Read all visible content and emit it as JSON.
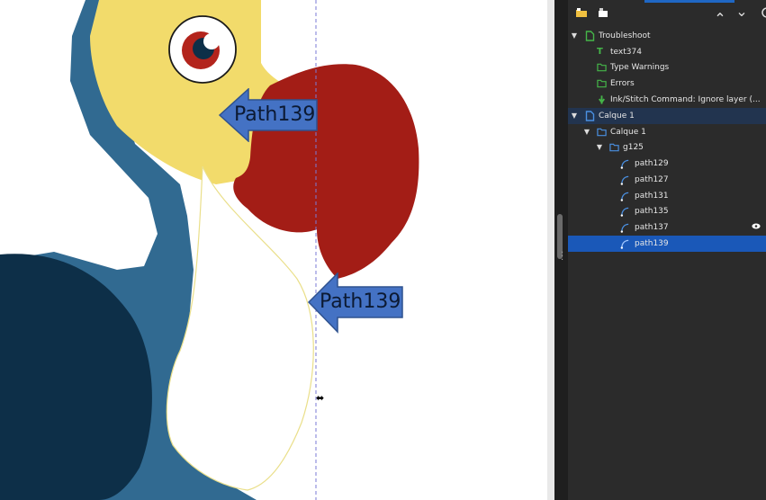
{
  "canvas": {
    "callouts": [
      {
        "id": "upper",
        "label": "Path139"
      },
      {
        "id": "lower",
        "label": "Path139"
      }
    ],
    "cursor_glyph": "⬌"
  },
  "colors": {
    "beak_red": "#a31d16",
    "head_yellow": "#f2db6b",
    "body_blue": "#316a91",
    "wing_dark": "#0d2f48",
    "callout_blue": "#4472c4",
    "selection": "#1a58b8",
    "panel_bg": "#2b2b2b",
    "folder_green": "#45b649",
    "layer_blue": "#4a90e2"
  },
  "toolbar": {
    "icons": [
      "folder-add-icon",
      "layer-add-icon",
      "move-up-icon",
      "move-down-icon",
      "more-icon"
    ],
    "up_glyph": "⌃",
    "down_glyph": "⌄"
  },
  "tree": {
    "rows": [
      {
        "label": "Troubleshoot",
        "icon": "layer-icon-green",
        "expanded": true
      },
      {
        "label": "text374",
        "icon": "text-icon"
      },
      {
        "label": "Type Warnings",
        "icon": "folder-icon-green"
      },
      {
        "label": "Errors",
        "icon": "folder-icon-green"
      },
      {
        "label": "Ink/Stitch Command: Ignore layer (...",
        "icon": "ink-stitch-command-icon"
      },
      {
        "label": "Calque 1",
        "icon": "layer-icon-blue",
        "expanded": true
      },
      {
        "label": "Calque 1",
        "icon": "folder-icon-blue",
        "expanded": true
      },
      {
        "label": "g125",
        "icon": "group-folder-icon",
        "expanded": true
      },
      {
        "label": "path129",
        "icon": "path-icon"
      },
      {
        "label": "path127",
        "icon": "path-icon"
      },
      {
        "label": "path131",
        "icon": "path-icon"
      },
      {
        "label": "path135",
        "icon": "path-icon"
      },
      {
        "label": "path137",
        "icon": "path-icon",
        "trail": "👁"
      },
      {
        "label": "path139",
        "icon": "path-icon",
        "selected": true
      }
    ]
  }
}
